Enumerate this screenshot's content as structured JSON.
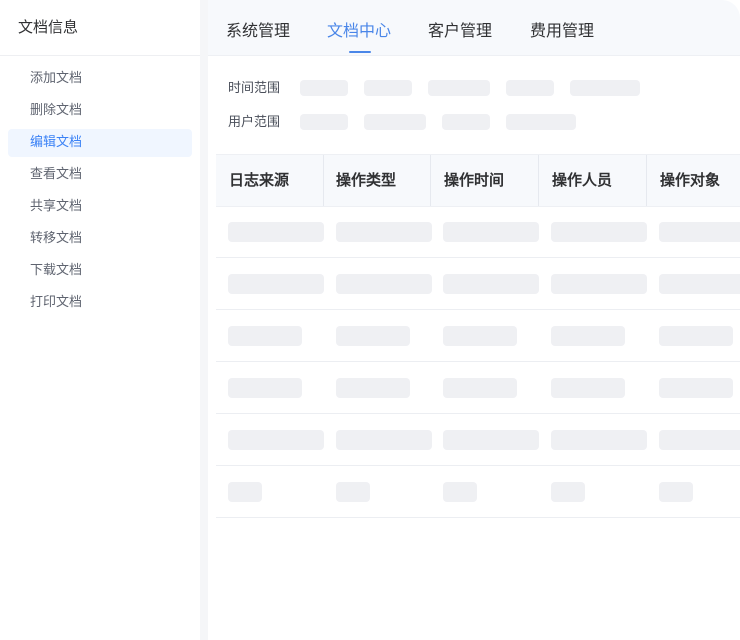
{
  "sidebar": {
    "title": "文档信息",
    "items": [
      {
        "label": "添加文档",
        "active": false
      },
      {
        "label": "删除文档",
        "active": false
      },
      {
        "label": "编辑文档",
        "active": true
      },
      {
        "label": "查看文档",
        "active": false
      },
      {
        "label": "共享文档",
        "active": false
      },
      {
        "label": "转移文档",
        "active": false
      },
      {
        "label": "下载文档",
        "active": false
      },
      {
        "label": "打印文档",
        "active": false
      }
    ]
  },
  "topnav": {
    "tabs": [
      {
        "label": "系统管理",
        "active": false
      },
      {
        "label": "文档中心",
        "active": true
      },
      {
        "label": "客户管理",
        "active": false
      },
      {
        "label": "费用管理",
        "active": false
      }
    ]
  },
  "filters": {
    "time_label": "时间范围",
    "user_label": "用户范围"
  },
  "table": {
    "columns": [
      "日志来源",
      "操作类型",
      "操作时间",
      "操作人员",
      "操作对象"
    ]
  },
  "colors": {
    "accent": "#4a86e8",
    "skeleton": "#eff0f3",
    "active_bg": "#f0f6ff"
  }
}
